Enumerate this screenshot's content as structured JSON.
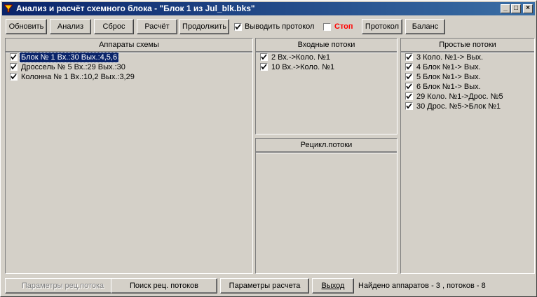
{
  "window": {
    "title": "Анализ и расчёт схемного блока - \"Блок 1 из Jul_blk.bks\"",
    "controls": [
      "_",
      "□",
      "×"
    ]
  },
  "toolbar": {
    "refresh": "Обновить",
    "analyze": "Анализ",
    "reset": "Сброс",
    "calculate": "Расчёт",
    "continue": "Продолжить",
    "output_protocol_label": "Выводить протокол",
    "output_protocol_checked": true,
    "stop_label": "Стоп",
    "stop_checked": false,
    "protocol": "Протокол",
    "balance": "Баланс"
  },
  "panels": {
    "apparatus": {
      "header": "Аппараты схемы",
      "items": [
        {
          "text": "Блок № 1 Вх.:30  Вых.:4,5,6",
          "checked": true,
          "selected": true
        },
        {
          "text": "Дроссель № 5 Вх.:29  Вых.:30",
          "checked": true,
          "selected": false
        },
        {
          "text": "Колонна № 1 Вх.:10,2  Вых.:3,29",
          "checked": true,
          "selected": false
        }
      ]
    },
    "input_streams": {
      "header": "Входные потоки",
      "items": [
        {
          "text": "2   Вх.->Коло. №1",
          "checked": true
        },
        {
          "text": "10   Вх.->Коло. №1",
          "checked": true
        }
      ]
    },
    "recycle_streams": {
      "header": "Рецикл.потоки",
      "items": []
    },
    "simple_streams": {
      "header": "Простые потоки",
      "items": [
        {
          "text": "3  Коло. №1-> Вых.",
          "checked": true
        },
        {
          "text": "4  Блок №1-> Вых.",
          "checked": true
        },
        {
          "text": "5  Блок №1-> Вых.",
          "checked": true
        },
        {
          "text": "6  Блок №1-> Вых.",
          "checked": true
        },
        {
          "text": "29  Коло. №1->Дрос. №5",
          "checked": true
        },
        {
          "text": "30  Дрос. №5->Блок №1",
          "checked": true
        }
      ]
    }
  },
  "bottom": {
    "recycle_params": "Параметры рец.потока",
    "find_recycle": "Поиск рец. потоков",
    "calc_params": "Параметры расчета",
    "exit": "Выход",
    "status": "Найдено аппаратов - 3 , потоков - 8"
  },
  "colors": {
    "face": "#d4d0c8",
    "title_start": "#0a246a",
    "title_end": "#3a6ea5",
    "stop_text": "#ff0000",
    "selection": "#0a246a"
  }
}
